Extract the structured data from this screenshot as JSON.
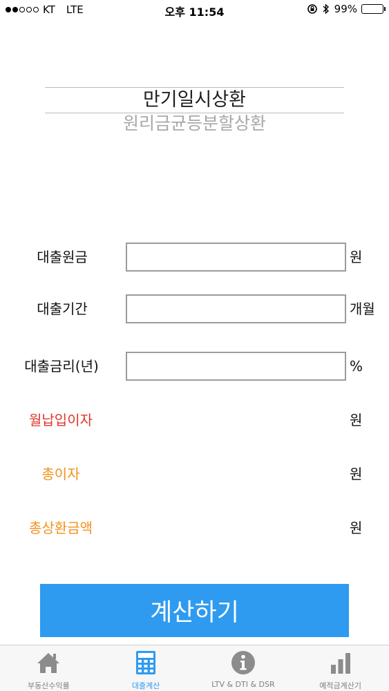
{
  "status_bar": {
    "carrier": "KT",
    "network": "LTE",
    "time": "오후 11:54",
    "battery": "99%",
    "battery_level": 0.99
  },
  "mode_selector": {
    "active": "만기일시상환",
    "inactive": "원리금균등분할상환"
  },
  "form": {
    "principal": {
      "label": "대출원금",
      "unit": "원",
      "value": ""
    },
    "period": {
      "label": "대출기간",
      "unit": "개월",
      "value": ""
    },
    "rate": {
      "label": "대출금리(년)",
      "unit": "%",
      "value": ""
    }
  },
  "results": {
    "monthly_interest": {
      "label": "월납입이자",
      "unit": "원",
      "color": "#e0352b"
    },
    "total_interest": {
      "label": "총이자",
      "unit": "원",
      "color": "#f2911b"
    },
    "total_repayment": {
      "label": "총상환금액",
      "unit": "원",
      "color": "#f2911b"
    }
  },
  "calculate_button": {
    "label": "계산하기",
    "color": "#2e9bf0"
  },
  "tab_bar": {
    "active_index": 1,
    "tabs": [
      {
        "label": "부동산수익률",
        "icon": "home-icon"
      },
      {
        "label": "대출계산",
        "icon": "calculator-icon"
      },
      {
        "label": "LTV & DTI & DSR",
        "icon": "info-icon"
      },
      {
        "label": "예적금계산기",
        "icon": "bar-chart-icon"
      }
    ]
  }
}
